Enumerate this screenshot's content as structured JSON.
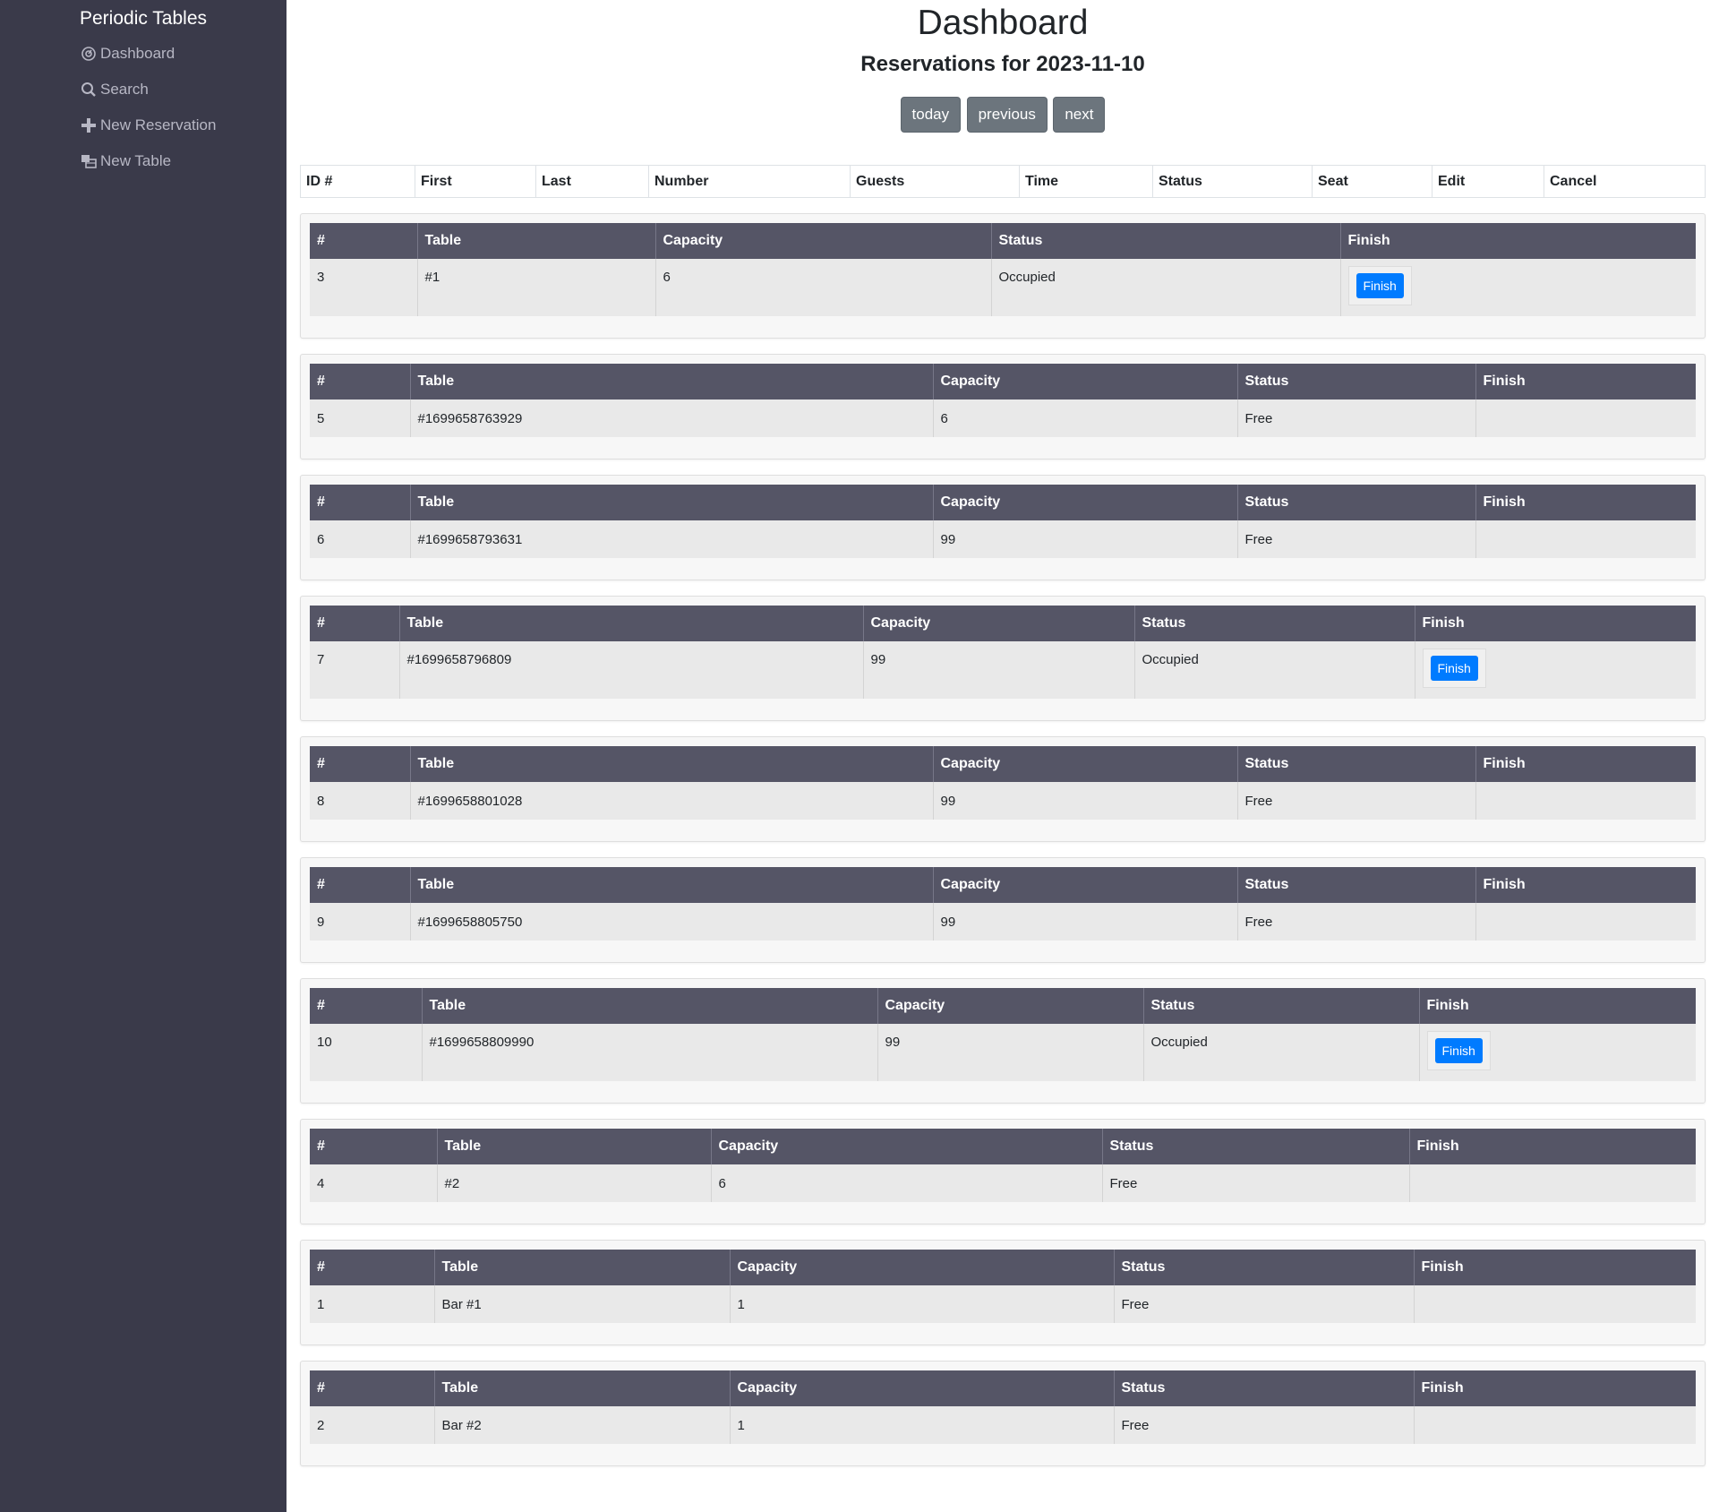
{
  "sidebar": {
    "brand": "Periodic Tables",
    "items": [
      {
        "label": "Dashboard",
        "icon": "dashboard-icon"
      },
      {
        "label": "Search",
        "icon": "search-icon"
      },
      {
        "label": "New Reservation",
        "icon": "plus-icon"
      },
      {
        "label": "New Table",
        "icon": "table-icon"
      }
    ]
  },
  "header": {
    "title": "Dashboard",
    "subtitle": "Reservations for 2023-11-10",
    "buttons": {
      "today": "today",
      "previous": "previous",
      "next": "next"
    }
  },
  "reservations": {
    "columns": [
      "ID #",
      "First",
      "Last",
      "Number",
      "Guests",
      "Time",
      "Status",
      "Seat",
      "Edit",
      "Cancel"
    ]
  },
  "tables": {
    "columns": [
      "#",
      "Table",
      "Capacity",
      "Status",
      "Finish"
    ],
    "finish_label": "Finish",
    "rows": [
      {
        "id": "3",
        "name": "#1",
        "capacity": "6",
        "status": "Occupied"
      },
      {
        "id": "5",
        "name": "#1699658763929",
        "capacity": "6",
        "status": "Free"
      },
      {
        "id": "6",
        "name": "#1699658793631",
        "capacity": "99",
        "status": "Free"
      },
      {
        "id": "7",
        "name": "#1699658796809",
        "capacity": "99",
        "status": "Occupied"
      },
      {
        "id": "8",
        "name": "#1699658801028",
        "capacity": "99",
        "status": "Free"
      },
      {
        "id": "9",
        "name": "#1699658805750",
        "capacity": "99",
        "status": "Free"
      },
      {
        "id": "10",
        "name": "#1699658809990",
        "capacity": "99",
        "status": "Occupied"
      },
      {
        "id": "4",
        "name": "#2",
        "capacity": "6",
        "status": "Free"
      },
      {
        "id": "1",
        "name": "Bar #1",
        "capacity": "1",
        "status": "Free"
      },
      {
        "id": "2",
        "name": "Bar #2",
        "capacity": "1",
        "status": "Free"
      }
    ]
  }
}
